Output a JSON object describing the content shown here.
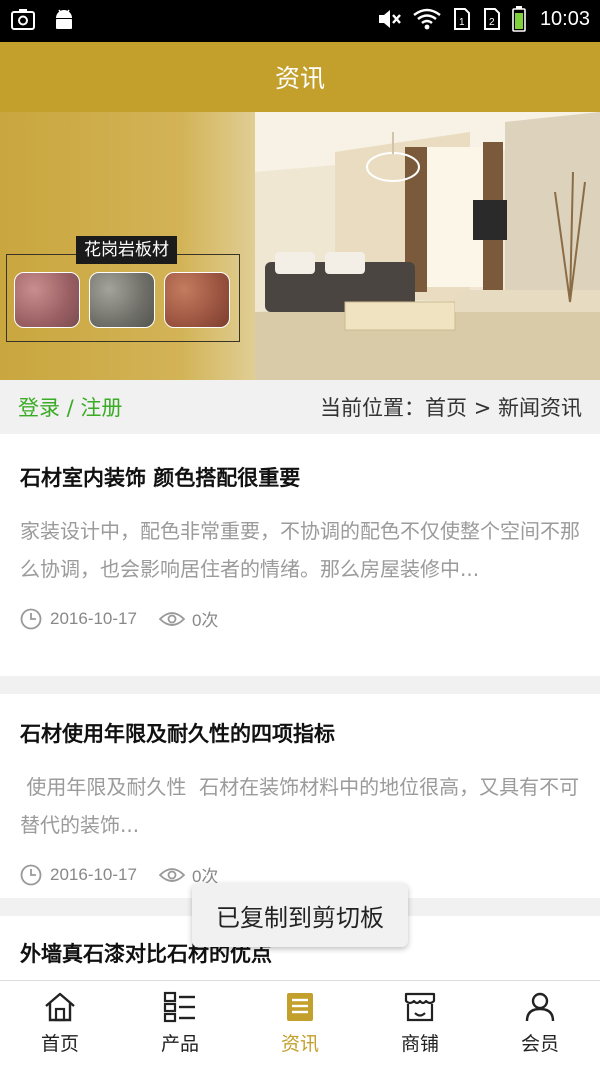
{
  "status_bar": {
    "time": "10:03",
    "icons": [
      "screenshot-icon",
      "android-icon",
      "mute-icon",
      "wifi-icon",
      "sim1-icon",
      "sim2-icon",
      "battery-icon"
    ]
  },
  "header": {
    "title": "资讯"
  },
  "banner": {
    "label": "花岗岩板材"
  },
  "crumb": {
    "login": "登录 / 注册",
    "location": "当前位置：首页 > 新闻资讯"
  },
  "articles": [
    {
      "title": "石材室内装饰 颜色搭配很重要",
      "summary": "家装设计中，配色非常重要，不协调的配色不仅使整个空间不那么协调，也会影响居住者的情绪。那么房屋装修中...",
      "date": "2016-10-17",
      "views": "0次"
    },
    {
      "title": "石材使用年限及耐久性的四项指标",
      "summary": " 使用年限及耐久性  石材在装饰材料中的地位很高，又具有不可替代的装饰...",
      "date": "2016-10-17",
      "views": "0次"
    },
    {
      "title": "外墙真石漆对比石材的优点"
    }
  ],
  "toast": {
    "text": "已复制到剪切板"
  },
  "bottom_nav": [
    {
      "label": "首页",
      "icon": "home-icon"
    },
    {
      "label": "产品",
      "icon": "product-list-icon"
    },
    {
      "label": "资讯",
      "icon": "news-icon",
      "active": true
    },
    {
      "label": "商铺",
      "icon": "shop-icon"
    },
    {
      "label": "会员",
      "icon": "member-icon"
    }
  ],
  "colors": {
    "brand": "#c39f2b",
    "login_green": "#3bab26",
    "summary_gray": "#9b9b9b"
  }
}
